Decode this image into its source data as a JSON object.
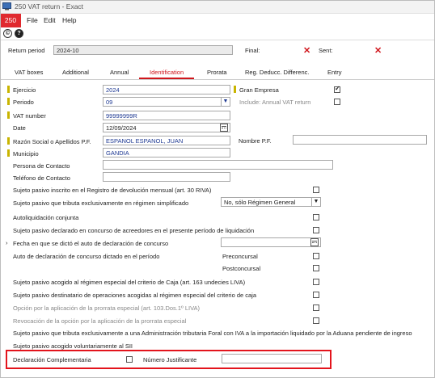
{
  "window": {
    "title": "250 VAT return - Exact",
    "app_icon": "monitor-icon"
  },
  "menubar": {
    "badge": "250",
    "items": [
      "File",
      "Edit",
      "Help"
    ]
  },
  "toolbar": {
    "icons": [
      "copyright-icon",
      "help-icon"
    ],
    "copyright_glyph": "©",
    "help_glyph": "?"
  },
  "header": {
    "return_period_label": "Return period",
    "return_period_value": "2024-10",
    "final_label": "Final:",
    "sent_label": "Sent:",
    "x_glyph": "✕"
  },
  "tabs": [
    {
      "label": "VAT boxes",
      "active": false
    },
    {
      "label": "Additional",
      "active": false
    },
    {
      "label": "Annual",
      "active": false
    },
    {
      "label": "Identification",
      "active": true
    },
    {
      "label": "Prorata",
      "active": false
    },
    {
      "label": "Reg. Deducc. Differenc.",
      "active": false
    },
    {
      "label": "Entry",
      "active": false
    }
  ],
  "form": {
    "ejercicio_label": "Ejercicio",
    "ejercicio_value": "2024",
    "periodo_label": "Periodo",
    "periodo_value": "09",
    "vat_number_label": "VAT number",
    "vat_number_value": "99999999R",
    "date_label": "Date",
    "date_value": "12/09/2024",
    "razon_label": "Razón Social o Apellidos P.F.",
    "razon_value": "ESPANOL ESPANOL, JUAN",
    "nombre_pf_label": "Nombre P.F.",
    "nombre_pf_value": "",
    "municipio_label": "Municipio",
    "municipio_value": "GANDIA",
    "persona_label": "Persona de Contacto",
    "persona_value": "",
    "telefono_label": "Teléfono de Contacto",
    "telefono_value": "",
    "gran_empresa_label": "Gran Empresa",
    "gran_empresa_checked": true,
    "include_annual_label": "Include: Annual VAT return",
    "include_annual_checked": false
  },
  "options": {
    "row1": "Sujeto pasivo inscrito en el Registro de devolución mensual (art. 30 RIVA)",
    "row2": "Sujeto pasivo que tributa exclusivamente en régimen simplificado",
    "row2_select": "No, sólo Régimen General",
    "row3": "Autoliquidación conjunta",
    "row4": "Sujeto pasivo declarado en concurso de acreedores en el presente período de liquidación",
    "row5": "Fecha en que se dictó el auto de declaración de concurso",
    "row6": "Auto de declaración de concurso dictado en el período",
    "preconcursal": "Preconcursal",
    "postconcursal": "Postconcursal",
    "row7": "Sujeto pasivo acogido al régimen especial del criterio de Caja (art. 163 undecies LIVA)",
    "row8": "Sujeto pasivo destinatario de operaciones acogidas al régimen especial del criterio de caja",
    "row9": "Opción por la aplicación de la prorrata especial (art. 103.Dos.1º LIVA)",
    "row10": "Revocación de la opción por la aplicación de la prorrata especial",
    "row11": "Sujeto pasivo que tributa exclusivamente a una Administración tributaria Foral con IVA a la importación liquidado por la Aduana pendiente de ingreso",
    "row12": "Sujeto pasivo acogido voluntariamente al SII",
    "declaracion_label": "Declaración Complementaria",
    "numero_label": "Número Justificante",
    "numero_value": ""
  },
  "colors": {
    "accent": "#d0161c",
    "badge": "#e0292e",
    "required_marker": "#c9b400"
  }
}
